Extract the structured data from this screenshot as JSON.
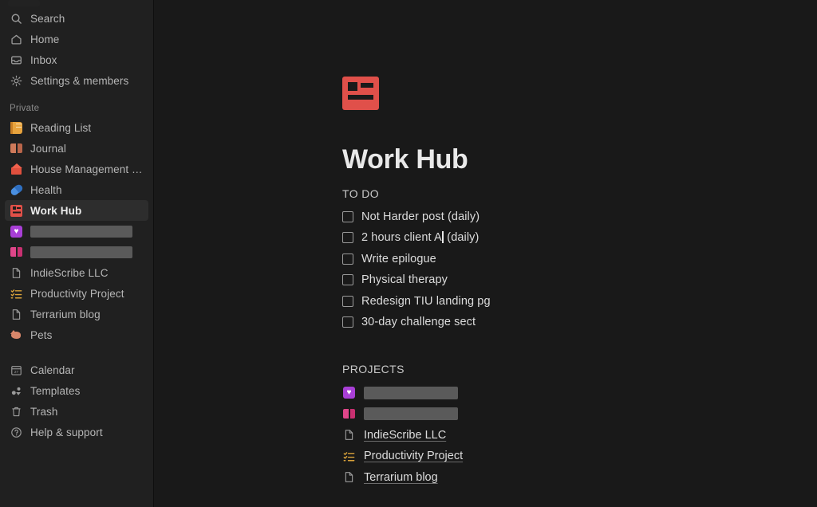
{
  "sidebar": {
    "top_nav": [
      {
        "label": "Search",
        "icon": "search-icon"
      },
      {
        "label": "Home",
        "icon": "home-icon"
      },
      {
        "label": "Inbox",
        "icon": "inbox-icon"
      },
      {
        "label": "Settings & members",
        "icon": "gear-icon"
      }
    ],
    "private_label": "Private",
    "private_items": [
      {
        "label": "Reading List",
        "icon": "notebook-emoji",
        "selected": false,
        "redacted": false
      },
      {
        "label": "Journal",
        "icon": "book-emoji",
        "selected": false,
        "redacted": false
      },
      {
        "label": "House Management Hub",
        "icon": "house-emoji",
        "selected": false,
        "redacted": false
      },
      {
        "label": "Health",
        "icon": "pill-emoji",
        "selected": false,
        "redacted": false
      },
      {
        "label": "Work Hub",
        "icon": "card-index-emoji",
        "selected": true,
        "redacted": false
      },
      {
        "label": "",
        "icon": "purple-heart-emoji",
        "selected": false,
        "redacted": true
      },
      {
        "label": "",
        "icon": "pink-book-emoji",
        "selected": false,
        "redacted": true
      },
      {
        "label": "IndieScribe LLC",
        "icon": "document-icon",
        "selected": false,
        "redacted": false
      },
      {
        "label": "Productivity Project",
        "icon": "checklist-icon",
        "selected": false,
        "redacted": false
      },
      {
        "label": "Terrarium blog",
        "icon": "document-icon",
        "selected": false,
        "redacted": false
      },
      {
        "label": "Pets",
        "icon": "pig-emoji",
        "selected": false,
        "redacted": false
      }
    ],
    "bottom_nav": [
      {
        "label": "Calendar",
        "icon": "calendar-icon",
        "day": "27"
      },
      {
        "label": "Templates",
        "icon": "templates-icon"
      },
      {
        "label": "Trash",
        "icon": "trash-icon"
      },
      {
        "label": "Help & support",
        "icon": "help-circle-icon"
      }
    ]
  },
  "page": {
    "icon": "card-index-emoji",
    "title": "Work Hub",
    "todo": {
      "heading": "TO DO",
      "items": [
        {
          "text": "Not Harder post (daily)",
          "checked": false,
          "caret": false
        },
        {
          "text_before": "2 hours client A",
          "text_after": " (daily)",
          "checked": false,
          "caret": true
        },
        {
          "text": "Write epilogue",
          "checked": false,
          "caret": false
        },
        {
          "text": "Physical therapy",
          "checked": false,
          "caret": false
        },
        {
          "text": "Redesign TIU landing pg",
          "checked": false,
          "caret": false
        },
        {
          "text": "30-day challenge sect",
          "checked": false,
          "caret": false
        }
      ]
    },
    "projects": {
      "heading": "PROJECTS",
      "items": [
        {
          "label": "",
          "icon": "purple-heart-emoji",
          "redacted": true
        },
        {
          "label": "",
          "icon": "pink-book-emoji",
          "redacted": true
        },
        {
          "label": "IndieScribe LLC",
          "icon": "document-icon",
          "redacted": false
        },
        {
          "label": "Productivity Project",
          "icon": "checklist-icon",
          "redacted": false
        },
        {
          "label": "Terrarium blog",
          "icon": "document-icon",
          "redacted": false
        }
      ]
    }
  },
  "colors": {
    "sidebar_bg": "#202020",
    "main_bg": "#191919",
    "selected_row": "#2d2d2d",
    "accent_red": "#e0504a",
    "redaction": "#5a5a5a"
  }
}
